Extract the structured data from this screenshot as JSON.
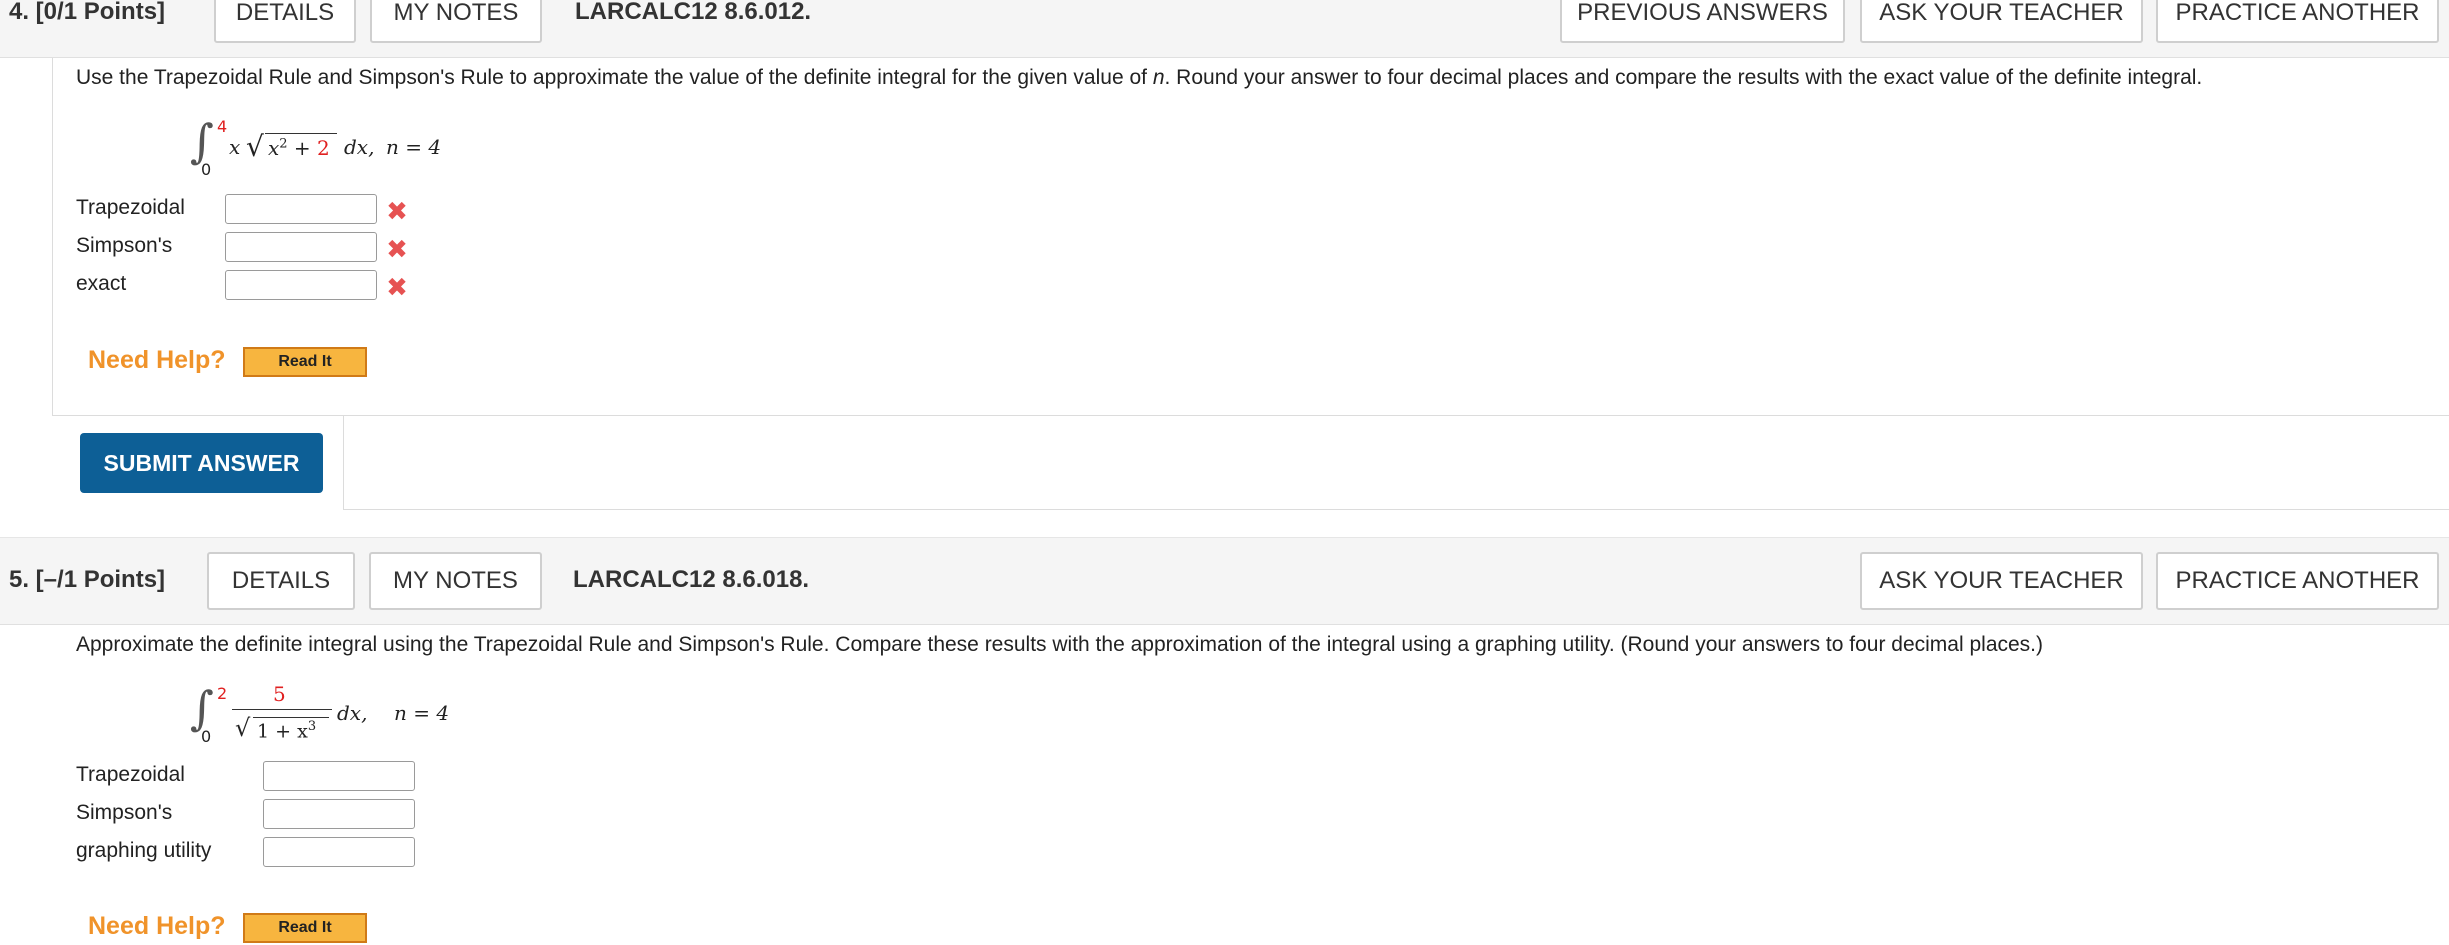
{
  "q4": {
    "number_label": "4. [0/1 Points]",
    "details": "DETAILS",
    "my_notes": "MY NOTES",
    "code": "LARCALC12 8.6.012.",
    "previous_answers": "PREVIOUS ANSWERS",
    "ask_teacher": "ASK YOUR TEACHER",
    "practice_another": "PRACTICE ANOTHER",
    "instructions_pre": "Use the Trapezoidal Rule and Simpson's Rule to approximate the value of the definite integral for the given value of ",
    "instructions_n": "n",
    "instructions_post": ". Round your answer to four decimal places and compare the results with the exact value of the definite integral.",
    "integral": {
      "upper": "4",
      "lower": "0",
      "x": "x",
      "radicand_a": "x",
      "radicand_exp": "2",
      "radicand_plus": "+",
      "radicand_b": "2",
      "dx": "dx,",
      "n_eq": "n = 4"
    },
    "fields": [
      {
        "label": "Trapezoidal",
        "value": "",
        "status": "incorrect"
      },
      {
        "label": "Simpson's",
        "value": "",
        "status": "incorrect"
      },
      {
        "label": "exact",
        "value": "",
        "status": "incorrect"
      }
    ],
    "need_help": "Need Help?",
    "read_it": "Read It",
    "submit": "SUBMIT ANSWER"
  },
  "q5": {
    "number_label": "5. [–/1 Points]",
    "details": "DETAILS",
    "my_notes": "MY NOTES",
    "code": "LARCALC12 8.6.018.",
    "ask_teacher": "ASK YOUR TEACHER",
    "practice_another": "PRACTICE ANOTHER",
    "instructions": "Approximate the definite integral using the Trapezoidal Rule and Simpson's Rule. Compare these results with the approximation of the integral using a graphing utility. (Round your answers to four decimal places.)",
    "integral": {
      "upper": "2",
      "lower": "0",
      "numerator": "5",
      "denominator_pre": "1 + x",
      "denominator_exp": "3",
      "dx": "dx,",
      "n_eq": "n = 4"
    },
    "fields": [
      {
        "label": "Trapezoidal",
        "value": ""
      },
      {
        "label": "Simpson's",
        "value": ""
      },
      {
        "label": "graphing utility",
        "value": ""
      }
    ],
    "need_help": "Need Help?",
    "read_it": "Read It"
  },
  "colors": {
    "accent_blue": "#0d5f96",
    "need_help_orange": "#f0932a",
    "read_it_fill": "#f7b53f",
    "error_red": "#e65252",
    "limit_red": "#e02020"
  },
  "icons": {
    "incorrect": "close-x-icon",
    "incorrect_glyph": "✖"
  }
}
